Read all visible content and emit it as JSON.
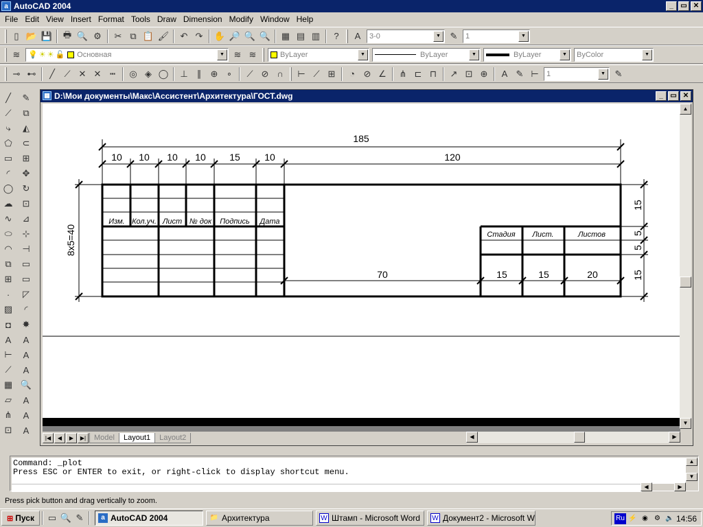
{
  "app": {
    "title": "AutoCAD 2004"
  },
  "menu": [
    "File",
    "Edit",
    "View",
    "Insert",
    "Format",
    "Tools",
    "Draw",
    "Dimension",
    "Modify",
    "Window",
    "Help"
  ],
  "toolbar": {
    "textstyle_value": "3-0",
    "scale_value": "1",
    "layer_value": "Основная",
    "color_value": "ByLayer",
    "linetype_value": "ByLayer",
    "lineweight_value": "ByLayer",
    "plotstyle_value": "ByColor",
    "dimstyle_value": "1"
  },
  "drawing_window": {
    "title": "D:\\Мои документы\\Макс\\Ассистент\\Архитектура\\ГОСТ.dwg"
  },
  "stamp": {
    "dim_total": "185",
    "dim_cols": [
      "10",
      "10",
      "10",
      "10",
      "15",
      "10",
      "120"
    ],
    "dim_height": "8x5=40",
    "dim_right": [
      "15",
      "5",
      "5",
      "15"
    ],
    "dim_bottom": [
      "70",
      "15",
      "15",
      "20"
    ],
    "headers": [
      "Изм.",
      "Кол.уч.",
      "Лист",
      "№ док",
      "Подпись",
      "Дата"
    ],
    "stage_headers": [
      "Стадия",
      "Лист.",
      "Листов"
    ]
  },
  "layout_tabs": [
    "Model",
    "Layout1",
    "Layout2"
  ],
  "command": {
    "line1": "Command: _plot",
    "line2": "Press ESC or ENTER to exit, or right-click to display shortcut menu."
  },
  "status": {
    "text": "Press pick button and drag vertically to zoom."
  },
  "taskbar": {
    "start": "Пуск",
    "tasks": [
      "AutoCAD 2004",
      "Архитектура",
      "Штамп - Microsoft Word",
      "Документ2 - Microsoft W..."
    ],
    "lang": "Ru",
    "clock": "14:56"
  }
}
